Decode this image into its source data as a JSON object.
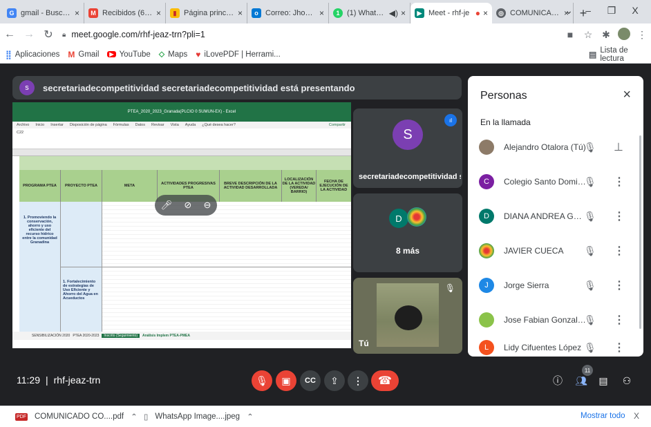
{
  "browser": {
    "tabs": [
      {
        "label": "gmail - Buscar co",
        "icon": "google-icon",
        "color": "#4285f4"
      },
      {
        "label": "Recibidos (650) -",
        "icon": "gmail-icon",
        "color": "#ea4335"
      },
      {
        "label": "Página principal",
        "icon": "youtube-like-icon",
        "color": "#fbbc05"
      },
      {
        "label": "Correo: Jhon Ale",
        "icon": "outlook-icon",
        "color": "#0078d4"
      },
      {
        "label": "(1) WhatsAp",
        "icon": "whatsapp-icon",
        "color": "#25d366"
      },
      {
        "label": "Meet - rhf-je",
        "icon": "meet-icon",
        "color": "#00897b"
      },
      {
        "label": "COMUNICADO C",
        "icon": "globe-icon",
        "color": "#5f6368"
      }
    ],
    "new_tab": "+",
    "window_controls": {
      "dropdown": "⌄",
      "minimize": "–",
      "restore": "❐",
      "close": "X"
    },
    "url": "meet.google.com/rhf-jeaz-trn?pli=1",
    "bookmarks": [
      {
        "label": "Aplicaciones",
        "icon": "apps-grid-icon"
      },
      {
        "label": "Gmail",
        "icon": "gmail-icon"
      },
      {
        "label": "YouTube",
        "icon": "youtube-icon"
      },
      {
        "label": "Maps",
        "icon": "maps-icon"
      },
      {
        "label": "iLovePDF | Herrami...",
        "icon": "ilovepdf-icon"
      }
    ],
    "reading_list": "Lista de lectura"
  },
  "meet": {
    "presenting_banner": "secretariadecompetitividad secretariadecompetitividad está presentando",
    "presenter_initial": "s",
    "presenter_tile_name": "secretariadecompetitividad s...",
    "presenter_tile_initial": "S",
    "more_tile_label": "8 más",
    "more_tile_initial": "D",
    "self_tile_label": "Tú",
    "time": "11:29",
    "separator": "|",
    "meeting_code": "rhf-jeaz-trn",
    "participant_count": "11"
  },
  "shared_sheet": {
    "title_bar": "PTEA_2020_2023_Granada(PLCIO 0 SUMUN-EX) - Excel",
    "menu": [
      "Archivo",
      "Inicio",
      "Insertar",
      "Disposición de página",
      "Fórmulas",
      "Datos",
      "Revisar",
      "Vista",
      "Ayuda",
      "¿Qué desea hacer?"
    ],
    "share": "Compartir",
    "cell_ref": "C22",
    "headers": [
      "PROGRAMA PTEA",
      "PROYECTO PTEA",
      "META",
      "ACTIVIDADES PROGRESIVAS PTEA",
      "BREVE DESCRIPCIÓN DE LA ACTIVIDAD DESARROLLADA",
      "LOCALIZACIÓN DE LA ACTIVIDAD (VEREDA/ BARRIO)",
      "FECHA DE EJECUCIÓN DE LA ACTIVIDAD"
    ],
    "row1_program": "1. Promoviendo la conservación, ahorro y uso eficiente del recurso hídrico entre la comunidad Granadina",
    "row2_project": "1. Fortalecimiento de estrategias de Uso Eficiente y Ahorro del Agua en Acueductos",
    "sheet_tabs": [
      "SENSIBILIZACIÓN 2020",
      "PTEA 2020-2023",
      "Inscrito (Seguimiento)",
      "Análisis Implem PTEA-PMEA"
    ]
  },
  "people_panel": {
    "title": "Personas",
    "section": "En la llamada",
    "participants": [
      {
        "name": "Alejandro Otalora (Tú)",
        "initial": "",
        "color": "#8d7b68",
        "pin": true
      },
      {
        "name": "Colegio Santo Domingo S...",
        "initial": "C",
        "color": "#7b1fa2"
      },
      {
        "name": "DIANA ANDREA GUERRE...",
        "initial": "D",
        "color": "#00796b"
      },
      {
        "name": "JAVIER CUECA",
        "initial": "",
        "color": "#f9a825"
      },
      {
        "name": "Jorge Sierra",
        "initial": "J",
        "color": "#1e88e5"
      },
      {
        "name": "Jose Fabian Gonzalez Ro...",
        "initial": "",
        "color": "#8bc34a"
      },
      {
        "name": "Lidy Cifuentes López",
        "initial": "L",
        "color": "#f4511e"
      }
    ]
  },
  "downloads": {
    "items": [
      {
        "label": "COMUNICADO CO....pdf",
        "icon": "pdf-icon"
      },
      {
        "label": "WhatsApp Image....jpeg",
        "icon": "image-file-icon"
      }
    ],
    "show_all": "Mostrar todo",
    "close": "X"
  }
}
